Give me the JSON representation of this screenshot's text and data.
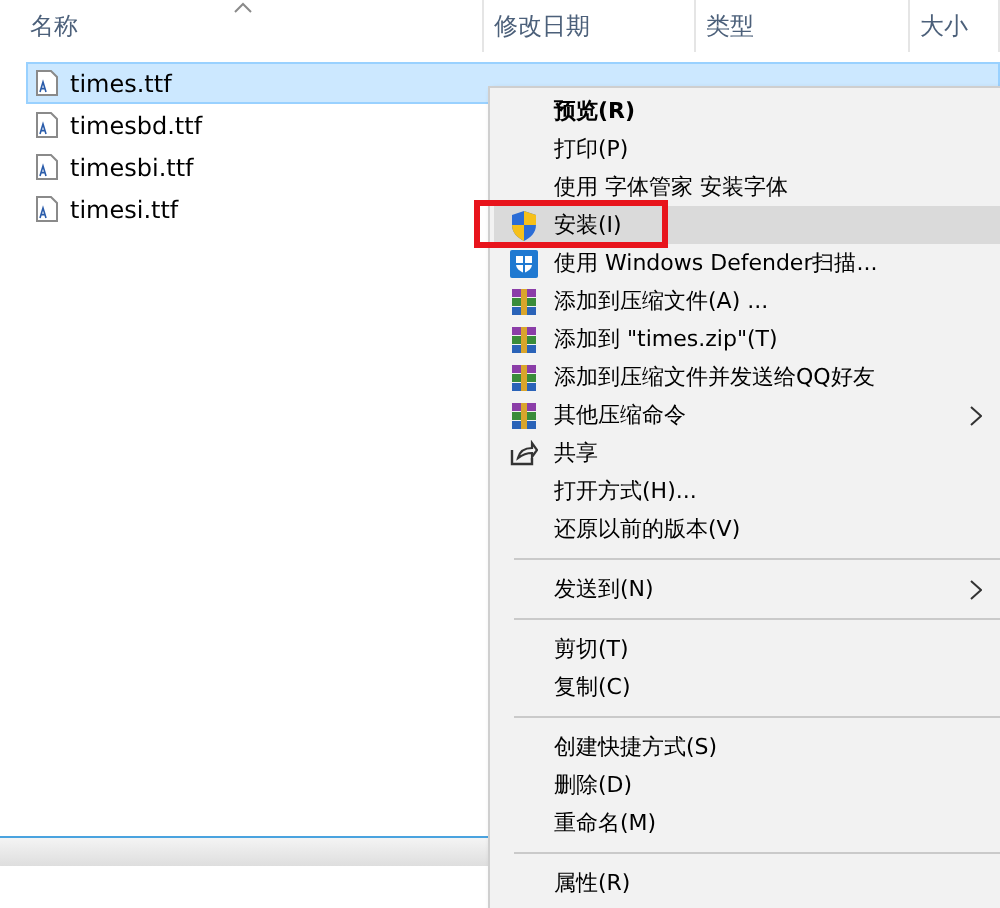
{
  "columns": [
    {
      "label": "名称",
      "sorted": true
    },
    {
      "label": "修改日期",
      "sorted": false
    },
    {
      "label": "类型",
      "sorted": false
    },
    {
      "label": "大小",
      "sorted": false
    }
  ],
  "files": [
    {
      "name": "times.ttf",
      "selected": true
    },
    {
      "name": "timesbd.ttf",
      "selected": false
    },
    {
      "name": "timesbi.ttf",
      "selected": false
    },
    {
      "name": "timesi.ttf",
      "selected": false
    }
  ],
  "context_menu": {
    "items": [
      {
        "kind": "item",
        "label": "预览(R)",
        "bold": true,
        "highlighted": false
      },
      {
        "kind": "item",
        "label": "打印(P)",
        "highlighted": false
      },
      {
        "kind": "item",
        "label": "使用 字体管家 安装字体",
        "highlighted": false
      },
      {
        "kind": "shield",
        "label": "安装(I)",
        "highlighted": true
      },
      {
        "kind": "defender",
        "label": "使用 Windows Defender扫描...",
        "highlighted": false
      },
      {
        "kind": "archive",
        "label": "添加到压缩文件(A) ...",
        "highlighted": false
      },
      {
        "kind": "archive",
        "label": "添加到 \"times.zip\"(T)",
        "highlighted": false
      },
      {
        "kind": "archive",
        "label": "添加到压缩文件并发送给QQ好友",
        "highlighted": false
      },
      {
        "kind": "archive",
        "label": "其他压缩命令",
        "submenu": true,
        "highlighted": false
      },
      {
        "kind": "share",
        "label": "共享",
        "highlighted": false
      },
      {
        "kind": "item",
        "label": "打开方式(H)...",
        "highlighted": false
      },
      {
        "kind": "item",
        "label": "还原以前的版本(V)",
        "highlighted": false
      },
      {
        "kind": "separator"
      },
      {
        "kind": "item",
        "label": "发送到(N)",
        "submenu": true,
        "highlighted": false
      },
      {
        "kind": "separator"
      },
      {
        "kind": "item",
        "label": "剪切(T)",
        "highlighted": false
      },
      {
        "kind": "item",
        "label": "复制(C)",
        "highlighted": false
      },
      {
        "kind": "separator"
      },
      {
        "kind": "item",
        "label": "创建快捷方式(S)",
        "highlighted": false
      },
      {
        "kind": "item",
        "label": "删除(D)",
        "highlighted": false
      },
      {
        "kind": "item",
        "label": "重命名(M)",
        "highlighted": false
      },
      {
        "kind": "separator"
      },
      {
        "kind": "item",
        "label": "属性(R)",
        "highlighted": false
      }
    ]
  }
}
